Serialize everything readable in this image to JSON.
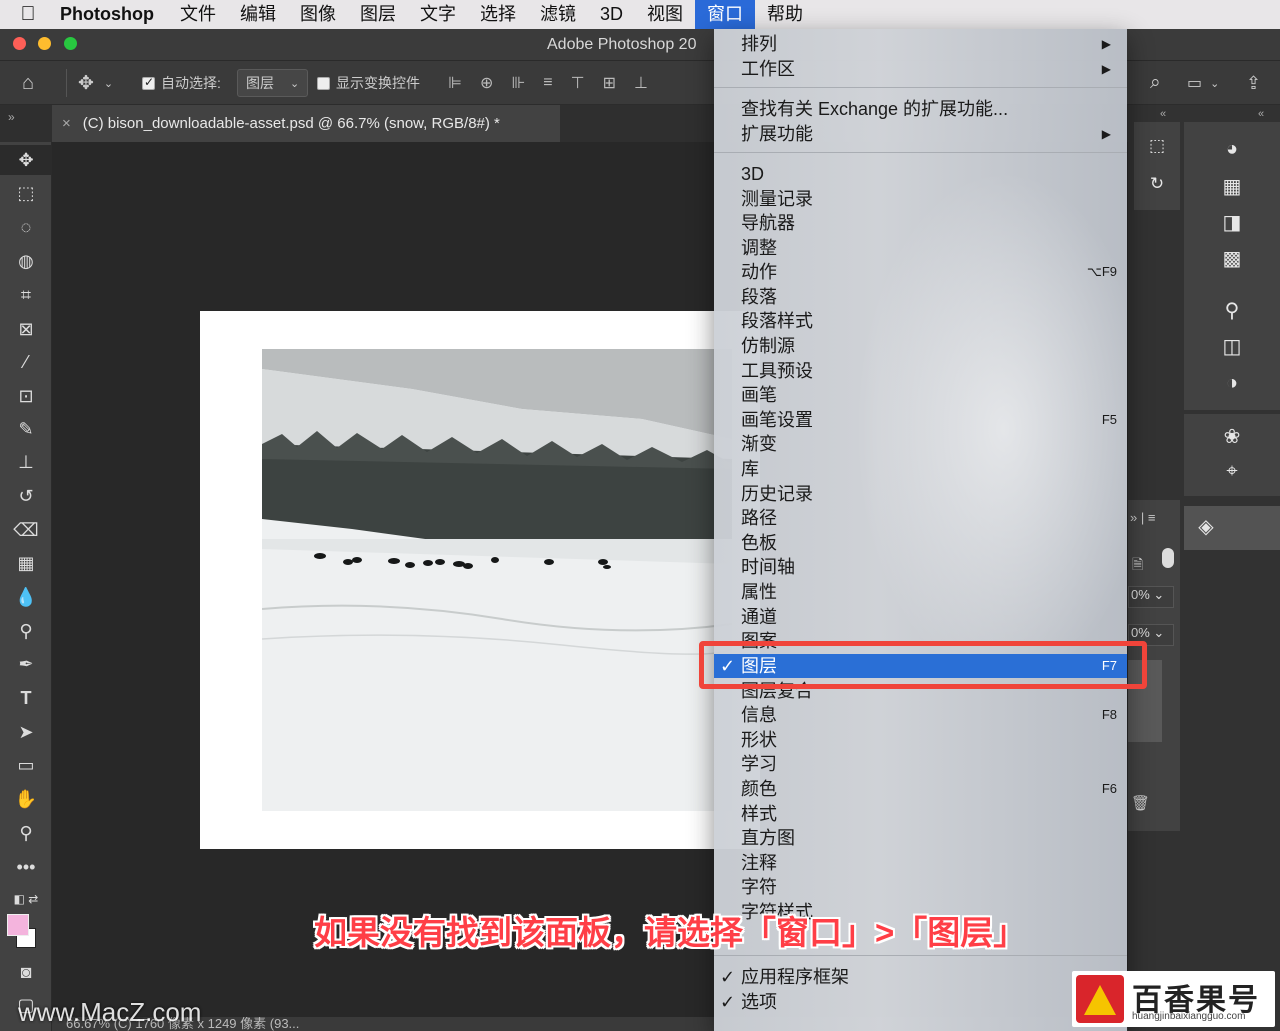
{
  "menubar": {
    "app_name": "Photoshop",
    "items": [
      "文件",
      "编辑",
      "图像",
      "图层",
      "文字",
      "选择",
      "滤镜",
      "3D",
      "视图",
      "窗口",
      "帮助"
    ],
    "active_item": "窗口"
  },
  "window": {
    "title": "Adobe Photoshop 20"
  },
  "options_bar": {
    "auto_select_label": "自动选择:",
    "auto_select_checked": true,
    "auto_select_target": "图层",
    "show_transform_label": "显示变换控件",
    "show_transform_checked": false
  },
  "document_tab": {
    "title": "(C) bison_downloadable-asset.psd @ 66.7% (snow, RGB/8#) *",
    "close_glyph": "×"
  },
  "status_bar": {
    "text": "66.67%      (C) 1760 像素 x 1249 像素 (93..."
  },
  "window_menu": {
    "items": [
      {
        "label": "排列",
        "submenu": true
      },
      {
        "label": "工作区",
        "submenu": true
      },
      {
        "separator": true
      },
      {
        "label": "查找有关 Exchange 的扩展功能..."
      },
      {
        "label": "扩展功能",
        "submenu": true
      },
      {
        "separator": true
      },
      {
        "label": "3D"
      },
      {
        "label": "测量记录"
      },
      {
        "label": "导航器"
      },
      {
        "label": "调整"
      },
      {
        "label": "动作",
        "shortcut": "⌥F9"
      },
      {
        "label": "段落"
      },
      {
        "label": "段落样式"
      },
      {
        "label": "仿制源"
      },
      {
        "label": "工具预设"
      },
      {
        "label": "画笔"
      },
      {
        "label": "画笔设置",
        "shortcut": "F5"
      },
      {
        "label": "渐变"
      },
      {
        "label": "库"
      },
      {
        "label": "历史记录"
      },
      {
        "label": "路径"
      },
      {
        "label": "色板"
      },
      {
        "label": "时间轴"
      },
      {
        "label": "属性"
      },
      {
        "label": "通道"
      },
      {
        "label": "图案"
      },
      {
        "label": "图层",
        "shortcut": "F7",
        "checked": true,
        "selected": true
      },
      {
        "label": "图层复合"
      },
      {
        "label": "信息",
        "shortcut": "F8"
      },
      {
        "label": "形状"
      },
      {
        "label": "学习"
      },
      {
        "label": "颜色",
        "shortcut": "F6"
      },
      {
        "label": "样式"
      },
      {
        "label": "直方图"
      },
      {
        "label": "注释"
      },
      {
        "label": "字符"
      },
      {
        "label": "字符样式"
      },
      {
        "separator": true
      },
      {
        "label": "应用程序框架",
        "checked": true
      },
      {
        "label": "选项",
        "checked": true
      }
    ]
  },
  "panel_values": {
    "opacity": "0%",
    "fill": "0%"
  },
  "caption": "如果没有找到该面板，请选择「窗口」>「图层」",
  "watermark_left": "www.MacZ.com",
  "watermark_right": {
    "title": "百香果号",
    "url": "huangjinbaixiangguo.com"
  },
  "colors": {
    "accent": "#2a6fd6",
    "highlight_box": "#f0443a",
    "caption": "#ff3e46",
    "foreground_swatch": "#f4b4dd"
  }
}
